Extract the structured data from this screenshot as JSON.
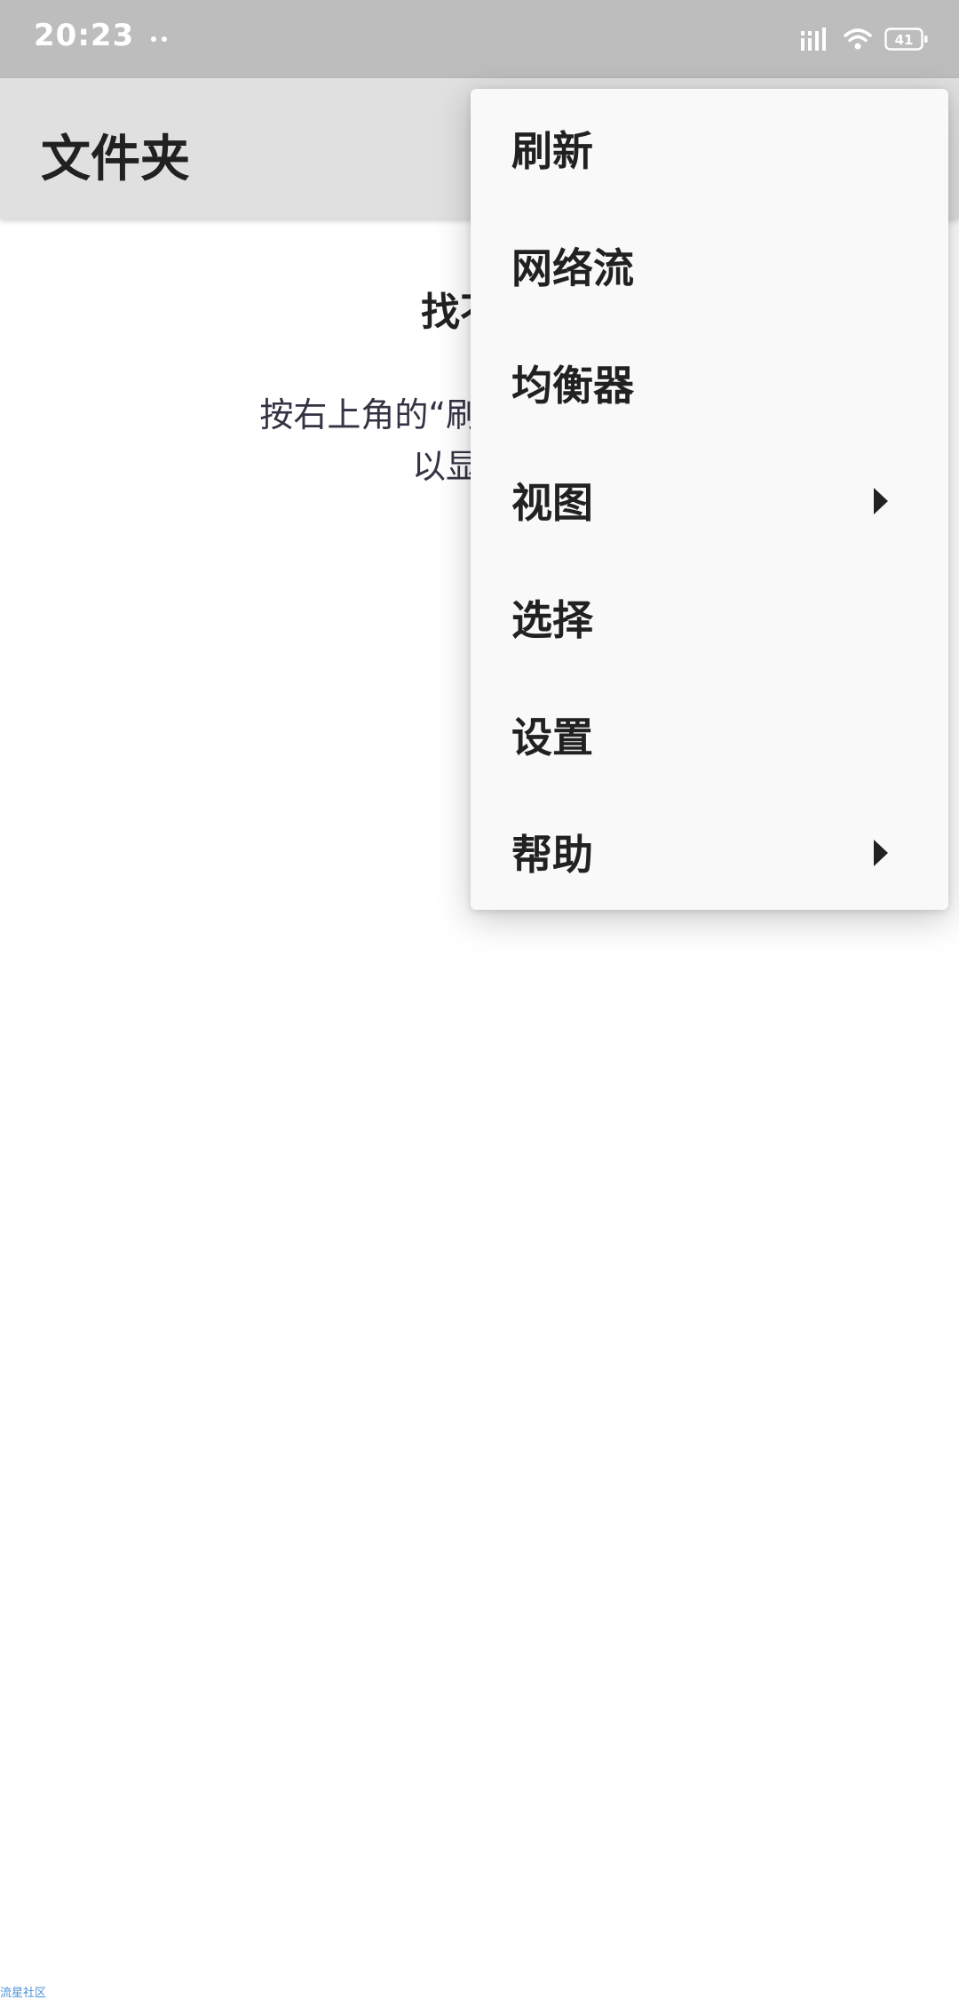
{
  "status_bar": {
    "time": "20:23",
    "battery_level": "41",
    "icons": [
      "notification-dots-icon",
      "signal-icon",
      "wifi-icon",
      "battery-icon"
    ]
  },
  "app_bar": {
    "title": "文件夹"
  },
  "empty_state": {
    "title": "找不到",
    "body": "按右上角的“刷新”按钮刷新列\n以显示隐"
  },
  "menu": {
    "items": [
      {
        "label": "刷新",
        "has_submenu": false
      },
      {
        "label": "网络流",
        "has_submenu": false
      },
      {
        "label": "均衡器",
        "has_submenu": false
      },
      {
        "label": "视图",
        "has_submenu": true
      },
      {
        "label": "选择",
        "has_submenu": false
      },
      {
        "label": "设置",
        "has_submenu": false
      },
      {
        "label": "帮助",
        "has_submenu": true
      }
    ]
  },
  "watermark": "流星社区",
  "colors": {
    "status_bar_bg": "#bdbdbd",
    "app_bar_bg": "#e0e0e0",
    "menu_bg": "#f9f9f9",
    "text_primary": "#212121",
    "watermark": "#4a90d9"
  }
}
